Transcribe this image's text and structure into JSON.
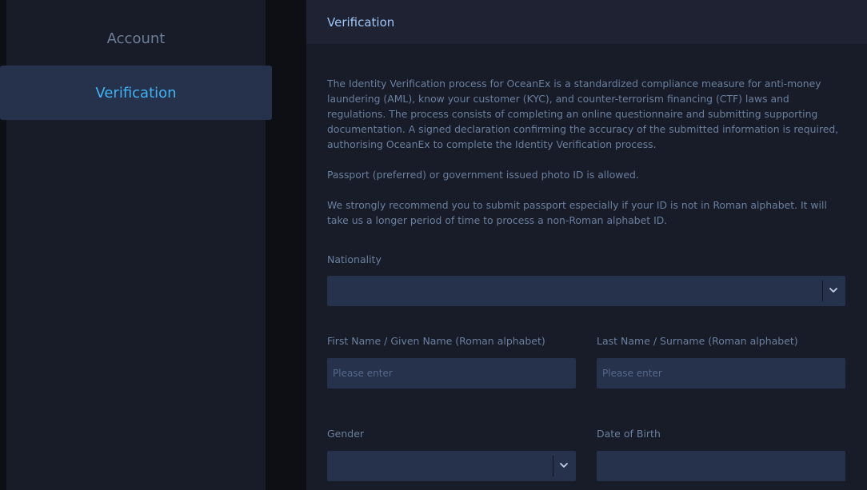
{
  "sidebar": {
    "items": [
      {
        "label": "Account"
      },
      {
        "label": "Verification"
      }
    ]
  },
  "main": {
    "title": "Verification",
    "paragraphs": [
      "The Identity Verification process for OceanEx is a standardized compliance measure for anti-money laundering (AML), know your customer (KYC), and counter-terrorism financing (CTF) laws and regulations. The process consists of completing an online questionnaire and submitting supporting documentation. A signed declaration confirming the accuracy of the submitted information is required, authorising OceanEx to complete the Identity Verification process.",
      "Passport (preferred) or government issued photo ID is allowed.",
      "We strongly recommend you to submit passport especially if your ID is not in Roman alphabet. It will take us a longer period of time to process a non-Roman alphabet ID."
    ],
    "form": {
      "nationality": {
        "label": "Nationality",
        "value": ""
      },
      "first_name": {
        "label": "First Name / Given Name (Roman alphabet)",
        "placeholder": "Please enter"
      },
      "last_name": {
        "label": "Last Name / Surname (Roman alphabet)",
        "placeholder": "Please enter"
      },
      "gender": {
        "label": "Gender",
        "value": ""
      },
      "dob": {
        "label": "Date of Birth",
        "value": ""
      }
    }
  },
  "colors": {
    "background": "#0d0f15",
    "panel": "#181c28",
    "field": "#26324b",
    "accent": "#41b3f5"
  },
  "icons": {
    "select_arrow": "chevron-down-icon"
  }
}
